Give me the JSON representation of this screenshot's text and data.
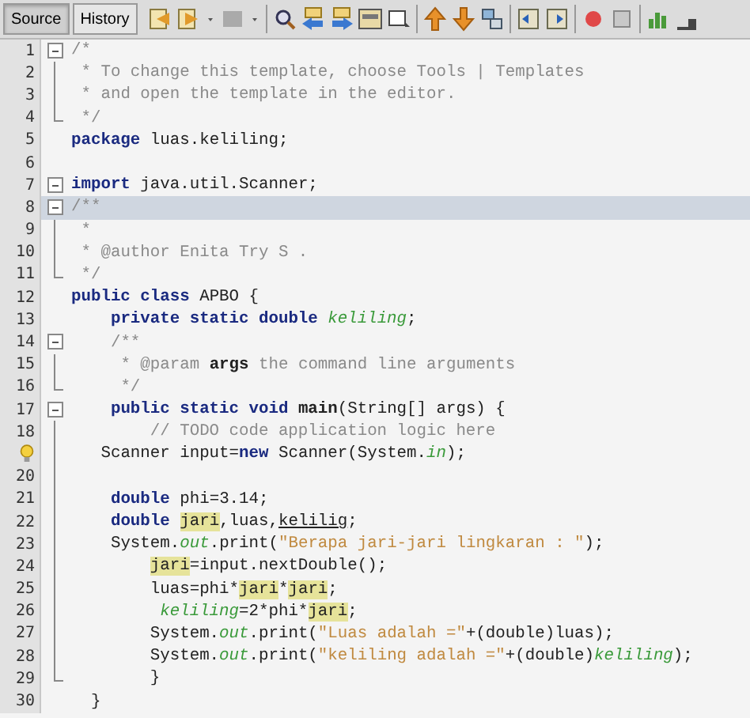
{
  "tabs": [
    {
      "label": "Source",
      "selected": true
    },
    {
      "label": "History",
      "selected": false
    }
  ],
  "lines": [
    {
      "number": "1",
      "kind": "start",
      "highlighted": false,
      "hint": false,
      "tokens": [
        {
          "kind": "comment",
          "text": "/*"
        }
      ]
    },
    {
      "number": "2",
      "kind": "body",
      "highlighted": false,
      "hint": false,
      "tokens": [
        {
          "kind": "comment",
          "text": " * To change this template, choose Tools | Templates"
        }
      ]
    },
    {
      "number": "3",
      "kind": "body",
      "highlighted": false,
      "hint": false,
      "tokens": [
        {
          "kind": "comment",
          "text": " * and open the template in the editor."
        }
      ]
    },
    {
      "number": "4",
      "kind": "end",
      "highlighted": false,
      "hint": false,
      "tokens": [
        {
          "kind": "comment",
          "text": " */"
        }
      ]
    },
    {
      "number": "5",
      "kind": "plain",
      "highlighted": false,
      "hint": false,
      "tokens": [
        {
          "kind": "keyword",
          "text": "package"
        },
        {
          "kind": "plain",
          "text": " luas.keliling;"
        }
      ]
    },
    {
      "number": "6",
      "kind": "plain",
      "highlighted": false,
      "hint": false
    },
    {
      "number": "7",
      "kind": "start",
      "highlighted": false,
      "hint": false,
      "tokens": [
        {
          "kind": "keyword",
          "text": "import"
        },
        {
          "kind": "plain",
          "text": " java.util.Scanner;"
        }
      ]
    },
    {
      "number": "8",
      "kind": "start",
      "highlighted": true,
      "hint": false,
      "tokens": [
        {
          "kind": "comment",
          "text": "/**"
        }
      ]
    },
    {
      "number": "9",
      "kind": "body",
      "highlighted": false,
      "hint": false,
      "tokens": [
        {
          "kind": "comment",
          "text": " *"
        }
      ]
    },
    {
      "number": "10",
      "kind": "body",
      "highlighted": false,
      "hint": false,
      "tokens": [
        {
          "kind": "comment",
          "text": " * @author Enita Try S ."
        }
      ]
    },
    {
      "number": "11",
      "kind": "end",
      "highlighted": false,
      "hint": false,
      "tokens": [
        {
          "kind": "comment",
          "text": " */"
        }
      ]
    },
    {
      "number": "12",
      "kind": "plain",
      "highlighted": false,
      "hint": false,
      "tokens": [
        {
          "kind": "keyword",
          "text": "public class"
        },
        {
          "kind": "plain",
          "text": " APBO {"
        }
      ]
    },
    {
      "number": "13",
      "kind": "plain",
      "highlighted": false,
      "hint": false,
      "tokens": [
        {
          "kind": "keyword",
          "text": "    private static double "
        },
        {
          "kind": "field",
          "text": "keliling"
        },
        {
          "kind": "plain",
          "text": ";"
        }
      ]
    },
    {
      "number": "14",
      "kind": "start",
      "highlighted": false,
      "hint": false,
      "tokens": [
        {
          "kind": "comment",
          "text": "    /**"
        }
      ]
    },
    {
      "number": "15",
      "kind": "body",
      "highlighted": false,
      "hint": false,
      "tokens": [
        {
          "kind": "comment",
          "text": "     * @param "
        },
        {
          "kind": "tag",
          "text": "args"
        },
        {
          "kind": "comment",
          "text": " the command line arguments"
        }
      ]
    },
    {
      "number": "16",
      "kind": "end",
      "highlighted": false,
      "hint": false,
      "tokens": [
        {
          "kind": "comment",
          "text": "     */"
        }
      ]
    },
    {
      "number": "17",
      "kind": "start",
      "highlighted": false,
      "hint": false,
      "tokens": [
        {
          "kind": "keyword",
          "text": "    public static void "
        },
        {
          "kind": "method",
          "text": "main"
        },
        {
          "kind": "plain",
          "text": "(String[] args) {"
        }
      ]
    },
    {
      "number": "18",
      "kind": "body",
      "highlighted": false,
      "hint": false,
      "tokens": [
        {
          "kind": "comment",
          "text": "        // TODO code application logic here"
        }
      ]
    },
    {
      "kind": "body",
      "highlighted": false,
      "hint": true,
      "tokens": [
        {
          "kind": "plain",
          "text": "   Scanner input="
        },
        {
          "kind": "keyword",
          "text": "new"
        },
        {
          "kind": "plain",
          "text": " Scanner(System."
        },
        {
          "kind": "static",
          "text": "in"
        },
        {
          "kind": "plain",
          "text": ");"
        }
      ]
    },
    {
      "number": "20",
      "kind": "body",
      "highlighted": false,
      "hint": false
    },
    {
      "number": "21",
      "kind": "body",
      "highlighted": false,
      "hint": false,
      "tokens": [
        {
          "kind": "keyword",
          "text": "    double"
        },
        {
          "kind": "plain",
          "text": " phi=3.14;"
        }
      ]
    },
    {
      "number": "22",
      "kind": "body",
      "highlighted": false,
      "hint": false,
      "tokens": [
        {
          "kind": "keyword",
          "text": "    double "
        },
        {
          "kind": "mark",
          "text": "jari"
        },
        {
          "kind": "plain",
          "text": ",luas,"
        },
        {
          "kind": "error",
          "text": "kelilig"
        },
        {
          "kind": "plain",
          "text": ";"
        }
      ]
    },
    {
      "number": "23",
      "kind": "body",
      "highlighted": false,
      "hint": false,
      "tokens": [
        {
          "kind": "plain",
          "text": "    System."
        },
        {
          "kind": "static",
          "text": "out"
        },
        {
          "kind": "plain",
          "text": ".print("
        },
        {
          "kind": "string",
          "text": "\"Berapa jari-jari lingkaran : \""
        },
        {
          "kind": "plain",
          "text": ");"
        }
      ]
    },
    {
      "number": "24",
      "kind": "body",
      "highlighted": false,
      "hint": false,
      "tokens": [
        {
          "kind": "mark",
          "text": "        jari"
        },
        {
          "kind": "plain",
          "text": "=input.nextDouble();"
        }
      ]
    },
    {
      "number": "25",
      "kind": "body",
      "highlighted": false,
      "hint": false,
      "tokens": [
        {
          "kind": "plain",
          "text": "        luas=phi*"
        },
        {
          "kind": "mark",
          "text": "jari"
        },
        {
          "kind": "plain",
          "text": "*"
        },
        {
          "kind": "mark",
          "text": "jari"
        },
        {
          "kind": "plain",
          "text": ";"
        }
      ]
    },
    {
      "number": "26",
      "kind": "body",
      "highlighted": false,
      "hint": false,
      "tokens": [
        {
          "kind": "field",
          "text": "         keliling"
        },
        {
          "kind": "plain",
          "text": "=2*phi*"
        },
        {
          "kind": "mark",
          "text": "jari"
        },
        {
          "kind": "plain",
          "text": ";"
        }
      ]
    },
    {
      "number": "27",
      "kind": "body",
      "highlighted": false,
      "hint": false,
      "tokens": [
        {
          "kind": "plain",
          "text": "        System."
        },
        {
          "kind": "static",
          "text": "out"
        },
        {
          "kind": "plain",
          "text": ".print("
        },
        {
          "kind": "string",
          "text": "\"Luas adalah =\""
        },
        {
          "kind": "plain",
          "text": "+(double)luas);"
        }
      ]
    },
    {
      "number": "28",
      "kind": "body",
      "highlighted": false,
      "hint": false,
      "tokens": [
        {
          "kind": "plain",
          "text": "        System."
        },
        {
          "kind": "static",
          "text": "out"
        },
        {
          "kind": "plain",
          "text": ".print("
        },
        {
          "kind": "string",
          "text": "\"keliling adalah =\""
        },
        {
          "kind": "plain",
          "text": "+(double)"
        },
        {
          "kind": "field",
          "text": "keliling"
        },
        {
          "kind": "plain",
          "text": ");"
        }
      ]
    },
    {
      "number": "29",
      "kind": "end",
      "highlighted": false,
      "hint": false,
      "tokens": [
        {
          "kind": "plain",
          "text": "        }"
        }
      ]
    },
    {
      "number": "30",
      "kind": "plain",
      "highlighted": false,
      "hint": false,
      "tokens": [
        {
          "kind": "plain",
          "text": "  }"
        }
      ]
    }
  ]
}
